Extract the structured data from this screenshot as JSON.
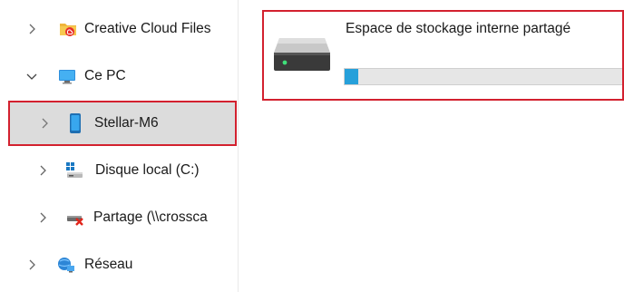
{
  "nav": {
    "items": [
      {
        "label": "Creative Cloud Files",
        "icon": "creative-cloud-folder-icon",
        "expand": "collapsed"
      },
      {
        "label": "Ce PC",
        "icon": "computer-icon",
        "expand": "expanded"
      },
      {
        "label": "Stellar-M6",
        "icon": "phone-icon",
        "expand": "collapsed",
        "selected": true
      },
      {
        "label": "Disque local (C:)",
        "icon": "local-disk-icon",
        "expand": "collapsed"
      },
      {
        "label": "Partage (\\\\crossca",
        "icon": "network-drive-disconnected-icon",
        "expand": "collapsed"
      },
      {
        "label": "Réseau",
        "icon": "network-icon",
        "expand": "collapsed"
      }
    ]
  },
  "content": {
    "device": {
      "title": "Espace de stockage interne partagé",
      "icon": "storage-drive-icon",
      "usage_fraction": 0.05
    }
  },
  "colors": {
    "highlight": "#d3212f",
    "selection": "#dcdcdc",
    "progress": "#26a0da"
  }
}
